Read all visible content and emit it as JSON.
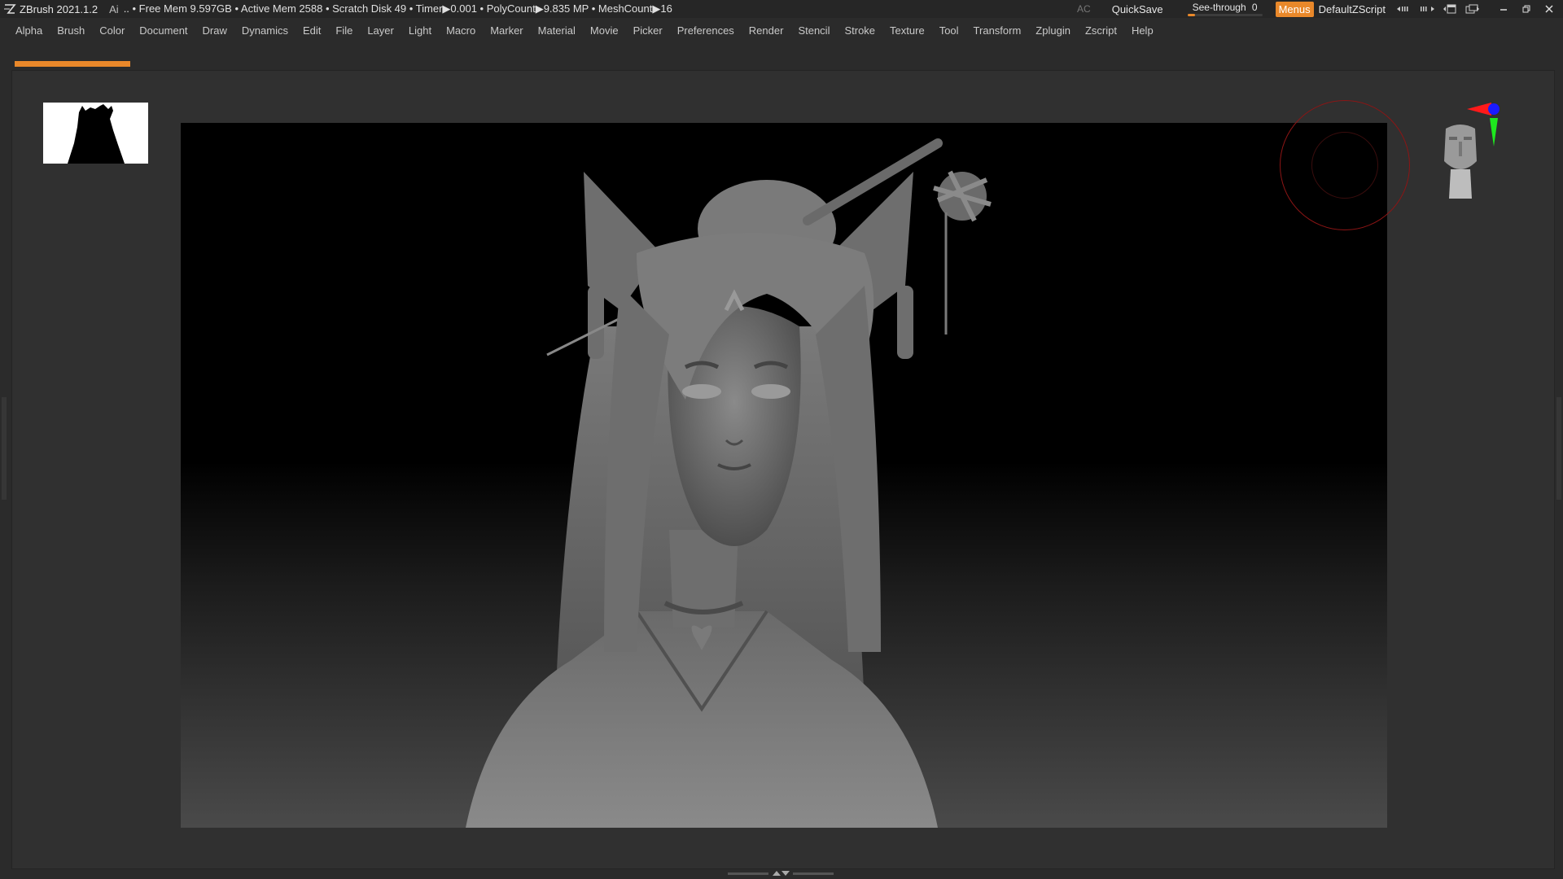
{
  "titlebar": {
    "app_title": "ZBrush 2021.1.2",
    "ai_label": "Ai",
    "stats": ".. • Free Mem 9.597GB • Active Mem 2588 • Scratch Disk 49 •  Timer▶0.001 • PolyCount▶9.835 MP  • MeshCount▶16",
    "ac_label": "AC",
    "quicksave_label": "QuickSave",
    "seethrough_label": "See-through",
    "seethrough_value": "0",
    "seethrough_level": 0.1,
    "menus_label": "Menus",
    "default_script_label": "DefaultZScript"
  },
  "menubar": {
    "items": [
      "Alpha",
      "Brush",
      "Color",
      "Document",
      "Draw",
      "Dynamics",
      "Edit",
      "File",
      "Layer",
      "Light",
      "Macro",
      "Marker",
      "Material",
      "Movie",
      "Picker",
      "Preferences",
      "Render",
      "Stencil",
      "Stroke",
      "Texture",
      "Tool",
      "Transform",
      "Zplugin",
      "Zscript",
      "Help"
    ]
  },
  "colors": {
    "accent": "#e9882a",
    "nav_circle": "#8c1515",
    "gizmo_red": "#ff1a1a",
    "gizmo_green": "#1ee81e",
    "gizmo_blue": "#1a1aff"
  },
  "icons": [
    "zbrush-logo-icon",
    "minimize-icon",
    "restore-icon",
    "close-icon",
    "navigation-head-icon",
    "axis-gizmo-icon"
  ]
}
